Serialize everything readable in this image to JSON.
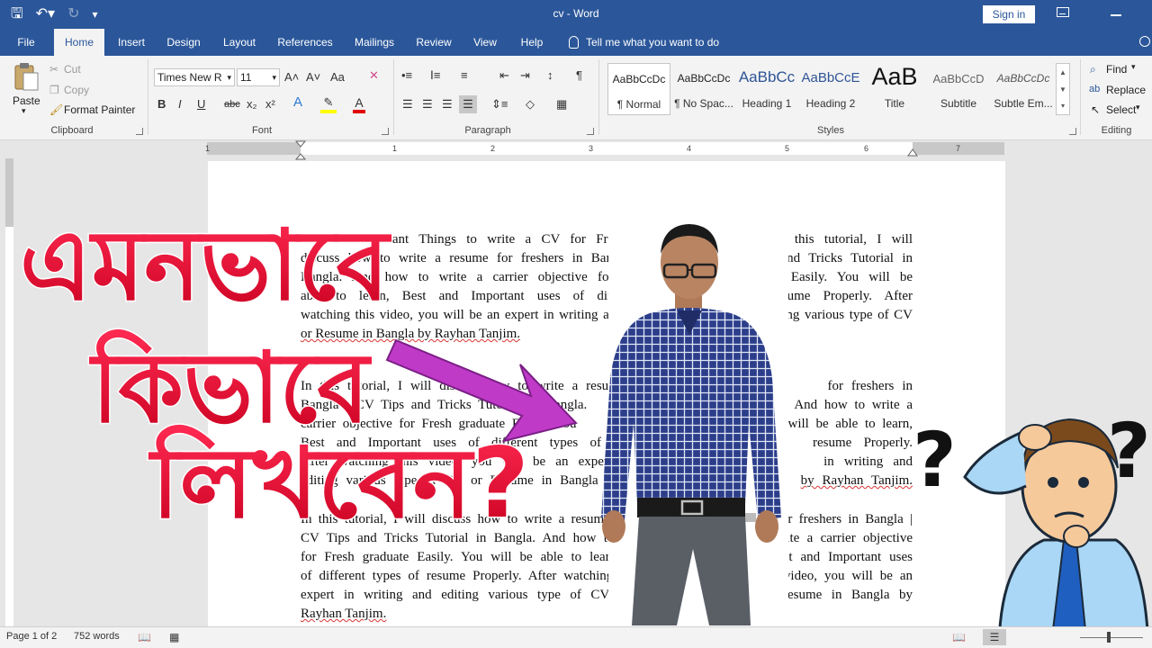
{
  "window": {
    "title": "cv  -  Word",
    "sign_in": "Sign in"
  },
  "tabs": [
    {
      "label": "File"
    },
    {
      "label": "Home"
    },
    {
      "label": "Insert"
    },
    {
      "label": "Design"
    },
    {
      "label": "Layout"
    },
    {
      "label": "References"
    },
    {
      "label": "Mailings"
    },
    {
      "label": "Review"
    },
    {
      "label": "View"
    },
    {
      "label": "Help"
    }
  ],
  "tell_me": "Tell me what you want to do",
  "clipboard": {
    "paste": "Paste",
    "cut": "Cut",
    "copy": "Copy",
    "format_painter": "Format Painter",
    "label": "Clipboard"
  },
  "font": {
    "name": "Times New R",
    "size": "11",
    "label": "Font",
    "bold": "B",
    "italic": "I",
    "underline": "U",
    "strike": "abc",
    "sub": "x₂",
    "sup": "x²",
    "grow": "A˄",
    "shrink": "A˅",
    "case": "Aa",
    "effects": "A",
    "color": "A"
  },
  "paragraph": {
    "label": "Paragraph"
  },
  "styles": {
    "label": "Styles",
    "items": [
      {
        "preview": "AaBbCcDc",
        "name": "¶ Normal"
      },
      {
        "preview": "AaBbCcDc",
        "name": "¶ No Spac..."
      },
      {
        "preview": "AaBbCc",
        "name": "Heading 1"
      },
      {
        "preview": "AaBbCcE",
        "name": "Heading 2"
      },
      {
        "preview": "AaB",
        "name": "Title"
      },
      {
        "preview": "AaBbCcD",
        "name": "Subtitle"
      },
      {
        "preview": "AaBbCcDc",
        "name": "Subtle Em..."
      }
    ]
  },
  "editing": {
    "find": "Find",
    "replace": "Replace",
    "select": "Select",
    "label": "Editing"
  },
  "ruler": {
    "numbers": [
      "1",
      "1",
      "2",
      "3",
      "4",
      "5",
      "6",
      "7"
    ]
  },
  "document": {
    "p1": [
      {
        "left": "7 Most Important Things to write a CV for Freshers",
        "right": "in Bangla in this tutorial, I will"
      },
      {
        "left": "discuss how to write a resume for freshers in Bangla | CV",
        "right": "Tips and Tricks Tutorial in"
      },
      {
        "left": "Bangla. And how to write a carrier objective for Fresh",
        "right": "graduate Easily. You will be"
      },
      {
        "left": "able to learn, Best and Important uses of different types of",
        "right": "resume Properly. After"
      },
      {
        "left": "watching this video, you will be an expert in writing and",
        "right": "editing various type of CV"
      },
      {
        "left": "or Resume in Bangla by Rayhan Tanjim.",
        "right": ""
      }
    ],
    "p2": [
      {
        "left": "In this tutorial, I will discuss how to write a resume",
        "right": "for freshers in"
      },
      {
        "left": "Bangla | CV Tips and Tricks Tutorial in Bangla.",
        "right": "And how to write a"
      },
      {
        "left": "carrier objective for Fresh graduate Easily. You",
        "right": "will be able to learn,"
      },
      {
        "left": "Best and Important uses of different types of",
        "right": "resume Properly."
      },
      {
        "left": "After watching this video, you will be an expert",
        "right": "in writing and"
      },
      {
        "left": "editing various type of CV or Resume in Bangla",
        "right": "by Rayhan Tanjim."
      }
    ],
    "p3": [
      {
        "left": "In this tutorial, I will discuss how to write a resume",
        "right": "for freshers in Bangla |"
      },
      {
        "left": "CV Tips and Tricks Tutorial in Bangla. And how to",
        "right": "write a carrier objective"
      },
      {
        "left": "for Fresh graduate Easily. You will be able to learn,",
        "right": "Best and Important uses"
      },
      {
        "left": "of different types of resume Properly. After watching",
        "right": "this video, you will be an"
      },
      {
        "left": "expert in writing and editing various type of CV or",
        "right": "Resume in Bangla by"
      },
      {
        "left": "Rayhan Tanjim.",
        "right": ""
      }
    ]
  },
  "overlay": {
    "line1": "এমনভাবে",
    "line2": "কিভাবে",
    "line3": "লিখবেন?",
    "question": "?"
  },
  "status": {
    "page": "Page 1 of 2",
    "words": "752 words"
  },
  "colors": {
    "ribbon_blue": "#2b579a",
    "bangla_red": "#e8002d",
    "arrow_magenta": "#c03ac8"
  }
}
